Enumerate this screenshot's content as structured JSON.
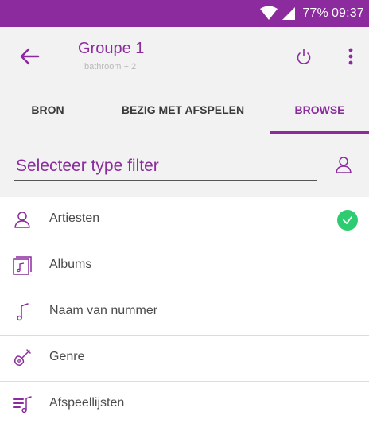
{
  "status": {
    "battery": "77%",
    "time": "09:37"
  },
  "header": {
    "title": "Groupe 1",
    "subtitle": "bathroom + 2"
  },
  "tabs": [
    {
      "label": "BRON",
      "active": false
    },
    {
      "label": "BEZIG MET AFSPELEN",
      "active": false
    },
    {
      "label": "BROWSE",
      "active": true
    }
  ],
  "filter": {
    "label": "Selecteer type filter"
  },
  "list": [
    {
      "label": "Artiesten",
      "icon": "person-icon",
      "selected": true
    },
    {
      "label": "Albums",
      "icon": "album-icon",
      "selected": false
    },
    {
      "label": "Naam van nummer",
      "icon": "music-note-icon",
      "selected": false
    },
    {
      "label": "Genre",
      "icon": "guitar-icon",
      "selected": false
    },
    {
      "label": "Afspeellijsten",
      "icon": "playlist-icon",
      "selected": false
    }
  ],
  "colors": {
    "accent": "#8b2b9e",
    "check": "#2ecc71",
    "background": "#f2f2f2"
  }
}
